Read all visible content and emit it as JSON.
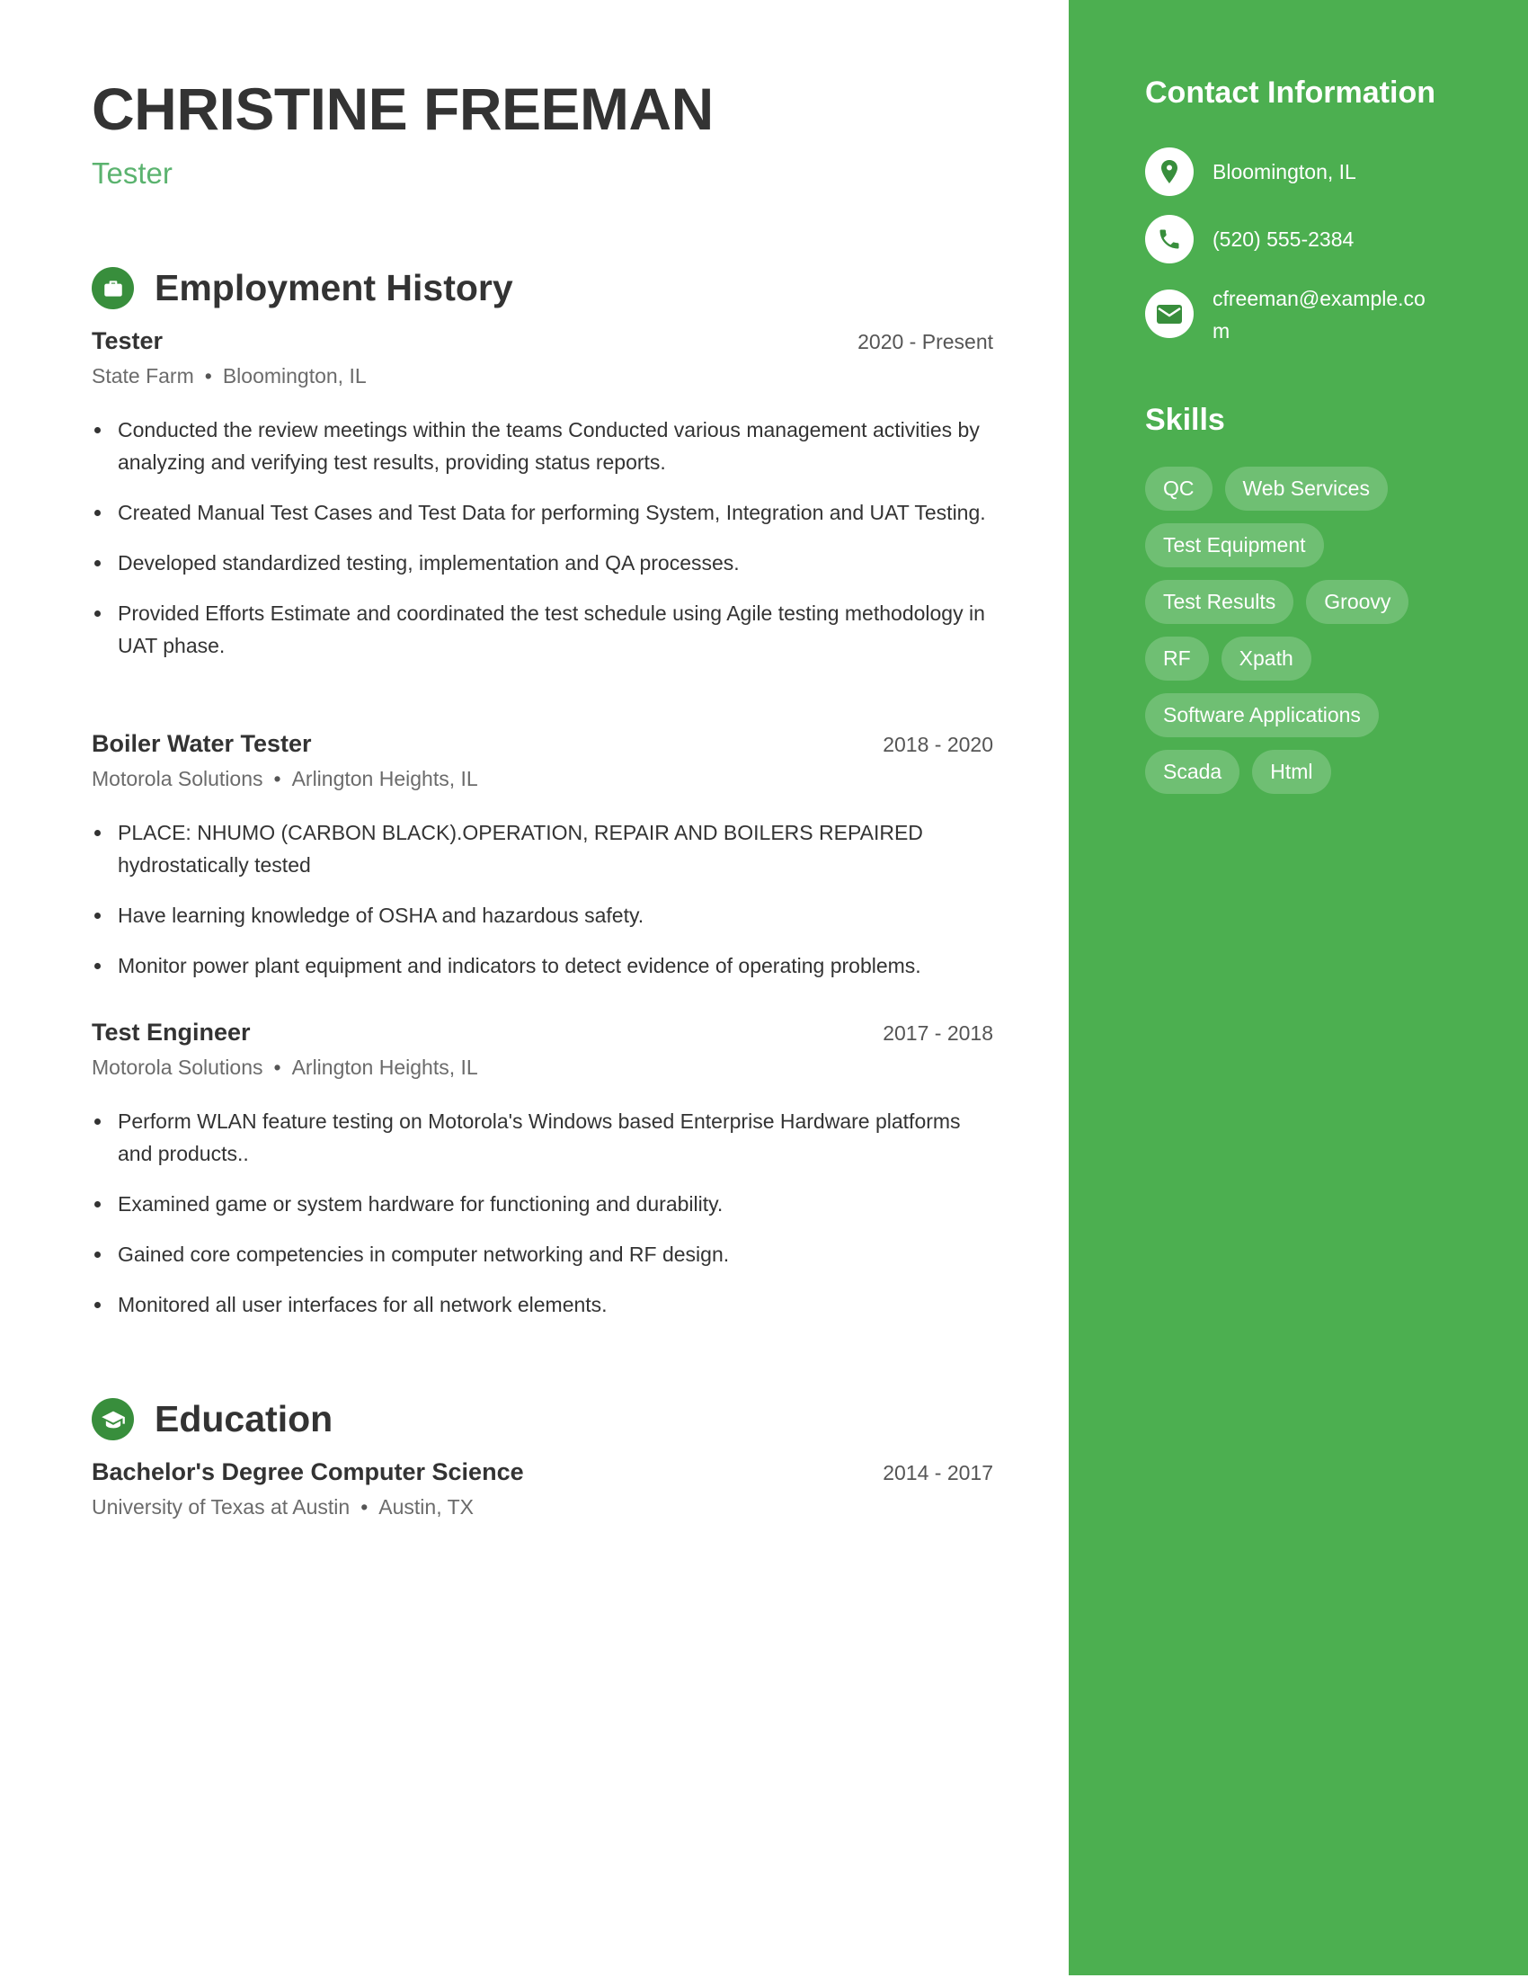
{
  "header": {
    "name": "CHRISTINE FREEMAN",
    "title": "Tester"
  },
  "colors": {
    "accent": "#4caf50",
    "accent_dark": "#388e3c",
    "title_green": "#5bb36f",
    "text": "#333333"
  },
  "employment": {
    "heading": "Employment History",
    "icon": "briefcase-icon",
    "jobs": [
      {
        "role": "Tester",
        "dates": "2020 - Present",
        "company": "State Farm",
        "location": "Bloomington, IL",
        "bullets": [
          "Conducted the review meetings within the teams Conducted various management activities by analyzing and verifying test results, providing status reports.",
          "Created Manual Test Cases and Test Data for performing System, Integration and UAT Testing.",
          "Developed standardized testing, implementation and QA processes.",
          "Provided Efforts Estimate and coordinated the test schedule using Agile testing methodology in UAT phase."
        ]
      },
      {
        "role": "Boiler Water Tester",
        "dates": "2018 - 2020",
        "company": "Motorola Solutions",
        "location": "Arlington Heights, IL",
        "bullets": [
          "PLACE: NHUMO (CARBON BLACK).OPERATION, REPAIR AND BOILERS REPAIRED hydrostatically tested",
          "Have learning knowledge of OSHA and hazardous safety.",
          "Monitor power plant equipment and indicators to detect evidence of operating problems."
        ]
      },
      {
        "role": "Test Engineer",
        "dates": "2017 - 2018",
        "company": "Motorola Solutions",
        "location": "Arlington Heights, IL",
        "bullets": [
          "Perform WLAN feature testing on Motorola's Windows based Enterprise Hardware platforms and products..",
          "Examined game or system hardware for functioning and durability.",
          "Gained core competencies in computer networking and RF design.",
          "Monitored all user interfaces for all network elements."
        ]
      }
    ]
  },
  "education": {
    "heading": "Education",
    "icon": "graduation-cap-icon",
    "entries": [
      {
        "degree": "Bachelor's Degree Computer Science",
        "dates": "2014 - 2017",
        "school": "University of Texas at Austin",
        "location": "Austin, TX"
      }
    ]
  },
  "sidebar": {
    "contact_heading": "Contact Information",
    "contact": [
      {
        "icon": "location-pin-icon",
        "text": "Bloomington, IL"
      },
      {
        "icon": "phone-icon",
        "text": "(520) 555-2384"
      },
      {
        "icon": "email-icon",
        "text": "cfreeman@example.com"
      }
    ],
    "skills_heading": "Skills",
    "skills": [
      "QC",
      "Web Services",
      "Test Equipment",
      "Test Results",
      "Groovy",
      "RF",
      "Xpath",
      "Software Applications",
      "Scada",
      "Html"
    ]
  },
  "separator": "•"
}
